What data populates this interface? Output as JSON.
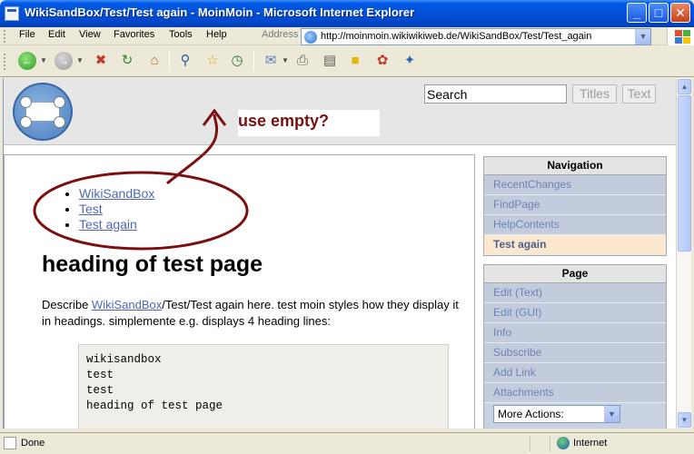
{
  "window": {
    "title": "WikiSandBox/Test/Test again - MoinMoin - Microsoft Internet Explorer"
  },
  "menu": {
    "items": [
      "File",
      "Edit",
      "View",
      "Favorites",
      "Tools",
      "Help"
    ],
    "address_label": "Address",
    "url": "http://moinmoin.wikiwikiweb.de/WikiSandBox/Test/Test_again"
  },
  "toolbar": {
    "icons": [
      "back-icon",
      "forward-icon",
      "stop-icon",
      "refresh-icon",
      "home-icon",
      "search-icon",
      "favorites-icon",
      "history-icon",
      "mail-icon",
      "print-icon",
      "edit-icon",
      "discuss-icon",
      "messenger-icon",
      "research-icon"
    ]
  },
  "header": {
    "search_value": "Search",
    "titles_label": "Titles",
    "text_label": "Text",
    "annotation": "use empty?"
  },
  "page": {
    "trail": [
      "WikiSandBox",
      "Test",
      "Test again"
    ],
    "heading": "heading of test page",
    "desc_pre": "Describe ",
    "desc_link": "WikiSandBox",
    "desc_post": "/Test/Test again here. test moin styles how they display it in headings. simplemente e.g. displays 4 heading lines:",
    "code_lines": "wikisandbox\ntest\ntest\nheading of test page"
  },
  "navigation": {
    "title": "Navigation",
    "items": [
      "RecentChanges",
      "FindPage",
      "HelpContents"
    ],
    "current": "Test again"
  },
  "page_panel": {
    "title": "Page",
    "items": [
      "Edit (Text)",
      "Edit (GUI)",
      "Info",
      "Subscribe",
      "Add Link",
      "Attachments"
    ],
    "more_actions": "More Actions:"
  },
  "status": {
    "text": "Done",
    "zone": "Internet"
  },
  "colors": {
    "annotation": "#7a1010",
    "link": "#4f68b3",
    "xp_title": "#0058e6"
  }
}
